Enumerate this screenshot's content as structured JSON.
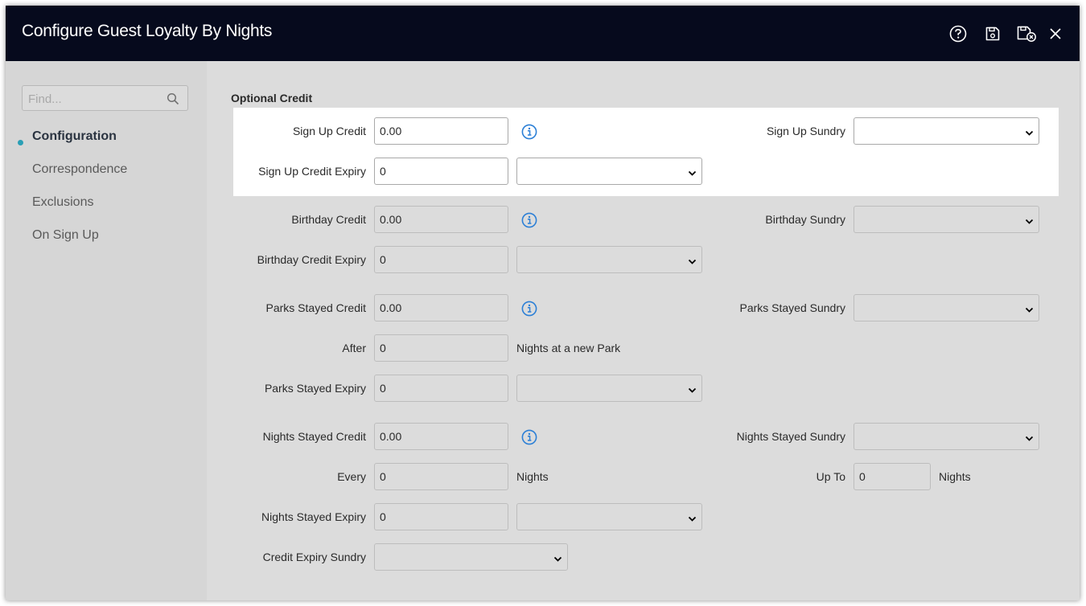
{
  "window": {
    "title": "Configure Guest Loyalty By Nights",
    "icons": [
      "help-icon",
      "save-icon",
      "save-and-close-icon",
      "close-icon"
    ]
  },
  "sidebar": {
    "find_placeholder": "Find...",
    "find_value": "",
    "items": [
      {
        "label": "Configuration",
        "active": true
      },
      {
        "label": "Correspondence",
        "active": false
      },
      {
        "label": "Exclusions",
        "active": false
      },
      {
        "label": "On Sign Up",
        "active": false
      }
    ]
  },
  "form": {
    "section_title": "Optional Credit",
    "sign_up_credit": {
      "label": "Sign Up Credit",
      "value": "0.00"
    },
    "sign_up_sundry": {
      "label": "Sign Up Sundry",
      "value": ""
    },
    "sign_up_credit_expiry": {
      "label": "Sign Up Credit Expiry",
      "value": "0",
      "unit": ""
    },
    "birthday_credit": {
      "label": "Birthday Credit",
      "value": "0.00"
    },
    "birthday_sundry": {
      "label": "Birthday Sundry",
      "value": ""
    },
    "birthday_credit_expiry": {
      "label": "Birthday Credit Expiry",
      "value": "0",
      "unit": ""
    },
    "parks_stayed_credit": {
      "label": "Parks Stayed Credit",
      "value": "0.00"
    },
    "parks_stayed_sundry": {
      "label": "Parks Stayed Sundry",
      "value": ""
    },
    "after": {
      "label": "After",
      "value": "0",
      "suffix": "Nights at a new Park"
    },
    "parks_stayed_expiry": {
      "label": "Parks Stayed Expiry",
      "value": "0",
      "unit": ""
    },
    "nights_stayed_credit": {
      "label": "Nights Stayed Credit",
      "value": "0.00"
    },
    "nights_stayed_sundry": {
      "label": "Nights Stayed Sundry",
      "value": ""
    },
    "every": {
      "label": "Every",
      "value": "0",
      "suffix": "Nights"
    },
    "up_to": {
      "label": "Up To",
      "value": "0",
      "suffix": "Nights"
    },
    "nights_stayed_expiry": {
      "label": "Nights Stayed Expiry",
      "value": "0",
      "unit": ""
    },
    "credit_expiry_sundry": {
      "label": "Credit Expiry Sundry",
      "value": ""
    }
  },
  "colors": {
    "titlebar": "#060a1d",
    "background": "#dcdcdc",
    "sidebar": "#d6d6d6",
    "accent": "#2a9fb5",
    "info_icon": "#2b7fd6"
  }
}
